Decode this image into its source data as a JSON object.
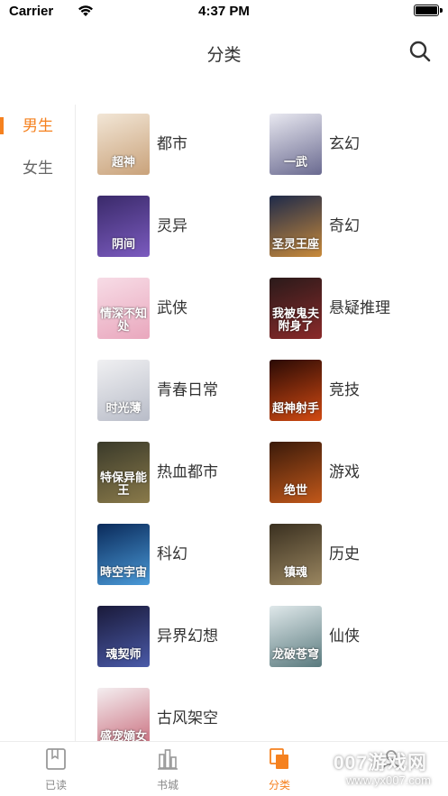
{
  "status_bar": {
    "carrier": "Carrier",
    "time": "4:37 PM"
  },
  "nav": {
    "title": "分类",
    "search_icon": "search-icon"
  },
  "side_nav": [
    {
      "label": "男生",
      "active": true
    },
    {
      "label": "女生",
      "active": false
    }
  ],
  "categories": [
    {
      "label": "都市",
      "cover_text": "超神",
      "cover_colors": [
        "#f2e6d6",
        "#c9a27a"
      ]
    },
    {
      "label": "玄幻",
      "cover_text": "一武",
      "cover_colors": [
        "#e8e8f0",
        "#6a6a90"
      ]
    },
    {
      "label": "灵异",
      "cover_text": "阴间",
      "cover_colors": [
        "#3a2a6a",
        "#7b5bbf"
      ]
    },
    {
      "label": "奇幻",
      "cover_text": "圣灵王座",
      "cover_colors": [
        "#1e2a4a",
        "#c98a3a"
      ]
    },
    {
      "label": "武侠",
      "cover_text": "情深不知处",
      "cover_colors": [
        "#f7dce6",
        "#e9a7bd"
      ]
    },
    {
      "label": "悬疑推理",
      "cover_text": "我被鬼夫附身了",
      "cover_colors": [
        "#2a1a1a",
        "#8a2a2a"
      ]
    },
    {
      "label": "青春日常",
      "cover_text": "时光薄",
      "cover_colors": [
        "#f0f0f2",
        "#b8bcc8"
      ]
    },
    {
      "label": "竞技",
      "cover_text": "超神射手",
      "cover_colors": [
        "#2a0a05",
        "#d24a12"
      ]
    },
    {
      "label": "热血都市",
      "cover_text": "特保异能王",
      "cover_colors": [
        "#3a3a2a",
        "#8a7a4a"
      ]
    },
    {
      "label": "游戏",
      "cover_text": "绝世",
      "cover_colors": [
        "#3a1a0a",
        "#c2581a"
      ]
    },
    {
      "label": "科幻",
      "cover_text": "時空宇宙",
      "cover_colors": [
        "#0a2a5a",
        "#4a9ad8"
      ]
    },
    {
      "label": "历史",
      "cover_text": "镇魂",
      "cover_colors": [
        "#3a3020",
        "#9a8660"
      ]
    },
    {
      "label": "异界幻想",
      "cover_text": "魂契师",
      "cover_colors": [
        "#1a1a3a",
        "#4a5aa8"
      ]
    },
    {
      "label": "仙侠",
      "cover_text": "龙破苍穹",
      "cover_colors": [
        "#dfe8ea",
        "#5a7a7e"
      ]
    },
    {
      "label": "古风架空",
      "cover_text": "盛宠嫡女",
      "cover_colors": [
        "#f4eef0",
        "#c86a7a"
      ]
    }
  ],
  "tabs": [
    {
      "label": "已读",
      "icon": "book-icon",
      "active": false
    },
    {
      "label": "书城",
      "icon": "library-icon",
      "active": false
    },
    {
      "label": "分类",
      "icon": "category-icon",
      "active": true
    },
    {
      "label": "",
      "icon": "profile-icon",
      "active": false
    }
  ],
  "watermark": {
    "text": "007游戏网",
    "url": "www.yx007.com"
  },
  "colors": {
    "accent": "#f5811f",
    "text": "#333333",
    "muted": "#888888"
  }
}
